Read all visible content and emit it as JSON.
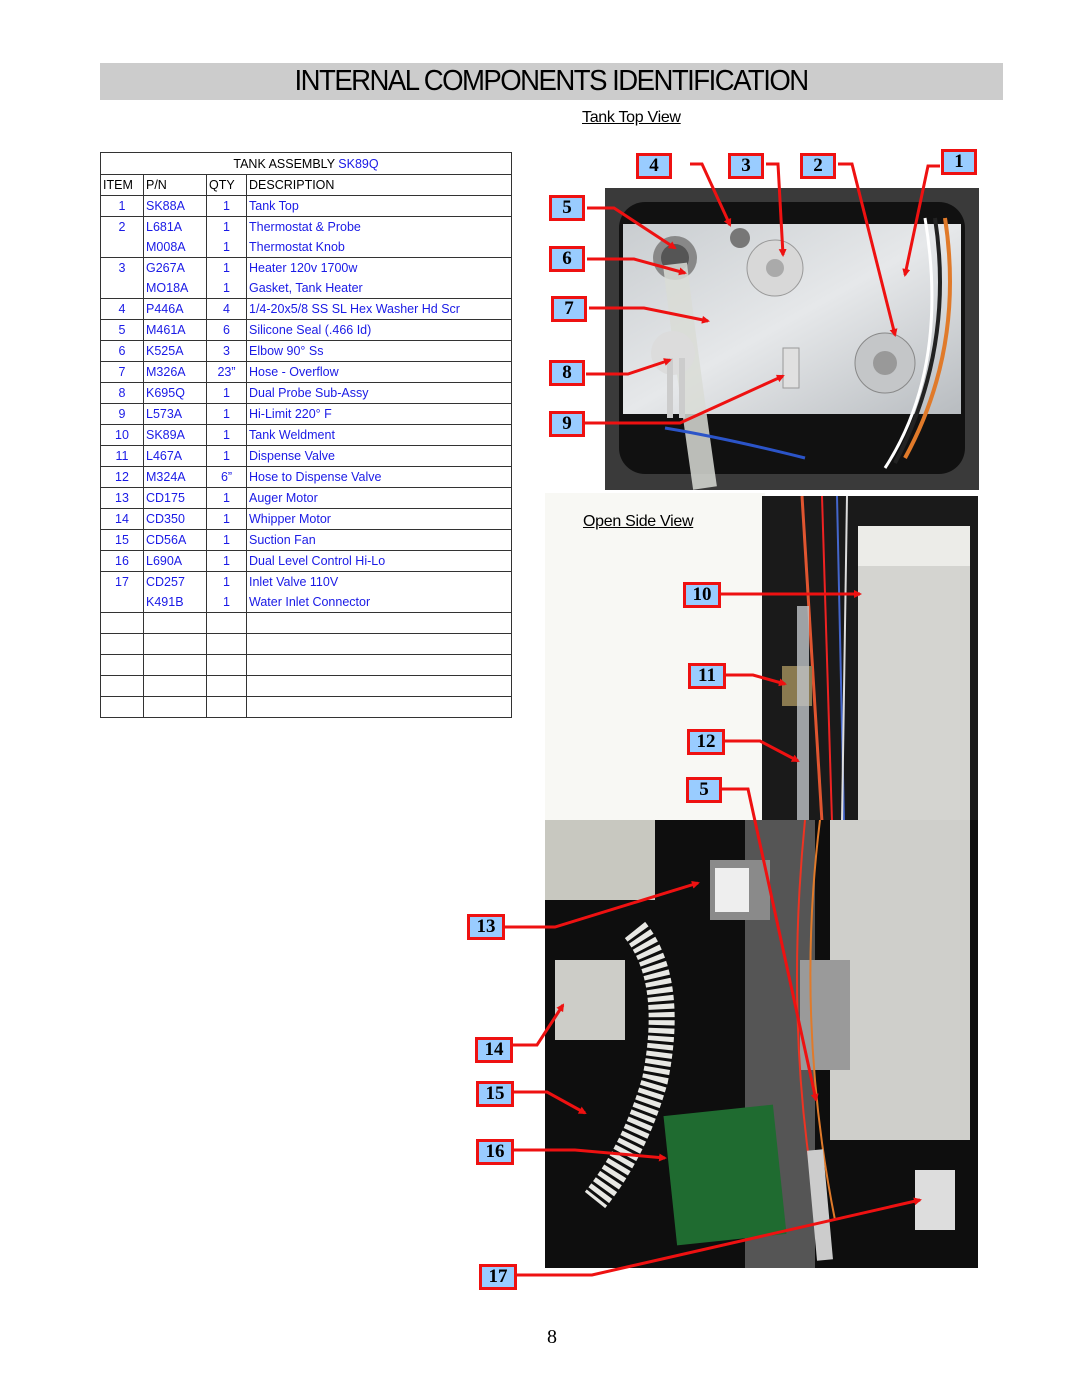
{
  "page": {
    "title": "INTERNAL COMPONENTS IDENTIFICATION",
    "tank_top_view_label": "Tank Top  View",
    "open_side_view_label": "Open Side View",
    "page_number": "8"
  },
  "parts_table": {
    "title_prefix": "TANK ASSEMBLY",
    "assembly_pn": "SK89Q",
    "headers": {
      "item": "ITEM",
      "pn": "P/N",
      "qty": "QTY",
      "description": "DESCRIPTION"
    },
    "rows": [
      {
        "item": "1",
        "pn": "SK88A",
        "qty": "1",
        "description": "Tank Top"
      },
      {
        "item": "2",
        "pn": "L681A",
        "qty": "1",
        "description": "Thermostat & Probe"
      },
      {
        "item": "",
        "pn": "M008A",
        "qty": "1",
        "description": "Thermostat Knob"
      },
      {
        "item": "3",
        "pn": "G267A",
        "qty": "1",
        "description": "Heater 120v 1700w"
      },
      {
        "item": "",
        "pn": "MO18A",
        "qty": "1",
        "description": "Gasket, Tank Heater"
      },
      {
        "item": "4",
        "pn": "P446A",
        "qty": "4",
        "description": "1/4-20x5/8 SS  SL Hex Washer Hd Scr"
      },
      {
        "item": "5",
        "pn": "M461A",
        "qty": "6",
        "description": "Silicone Seal (.466 Id)"
      },
      {
        "item": "6",
        "pn": "K525A",
        "qty": "3",
        "description": "Elbow 90° Ss"
      },
      {
        "item": "7",
        "pn": "M326A",
        "qty": "23”",
        "description": "Hose - Overflow"
      },
      {
        "item": "8",
        "pn": "K695Q",
        "qty": "1",
        "description": "Dual Probe Sub-Assy"
      },
      {
        "item": "9",
        "pn": "L573A",
        "qty": "1",
        "description": "Hi-Limit 220° F"
      },
      {
        "item": "10",
        "pn": "SK89A",
        "qty": "1",
        "description": "Tank Weldment"
      },
      {
        "item": "11",
        "pn": "L467A",
        "qty": "1",
        "description": "Dispense Valve"
      },
      {
        "item": "12",
        "pn": "M324A",
        "qty": "6”",
        "description": "Hose to Dispense Valve"
      },
      {
        "item": "13",
        "pn": "CD175",
        "qty": "1",
        "description": "Auger Motor"
      },
      {
        "item": "14",
        "pn": "CD350",
        "qty": "1",
        "description": "Whipper Motor"
      },
      {
        "item": "15",
        "pn": "CD56A",
        "qty": "1",
        "description": "Suction Fan"
      },
      {
        "item": "16",
        "pn": "L690A",
        "qty": "1",
        "description": "Dual Level Control Hi-Lo"
      },
      {
        "item": "17",
        "pn": "CD257",
        "qty": "1",
        "description": "Inlet Valve 110V"
      },
      {
        "item": "",
        "pn": "K491B",
        "qty": "1",
        "description": "Water Inlet Connector"
      }
    ],
    "empty_rows": 5
  },
  "callouts": {
    "tank_top": [
      "4",
      "3",
      "2",
      "1",
      "5",
      "6",
      "7",
      "8",
      "9"
    ],
    "side": [
      "10",
      "11",
      "12",
      "5"
    ],
    "bottom": [
      "13",
      "14",
      "15",
      "16",
      "17"
    ]
  },
  "colors": {
    "callout_fill": "#99ccff",
    "callout_border": "#ee1111",
    "arrow": "#ee1111",
    "table_text": "#1a1ae6",
    "title_bar": "#cccccc"
  }
}
